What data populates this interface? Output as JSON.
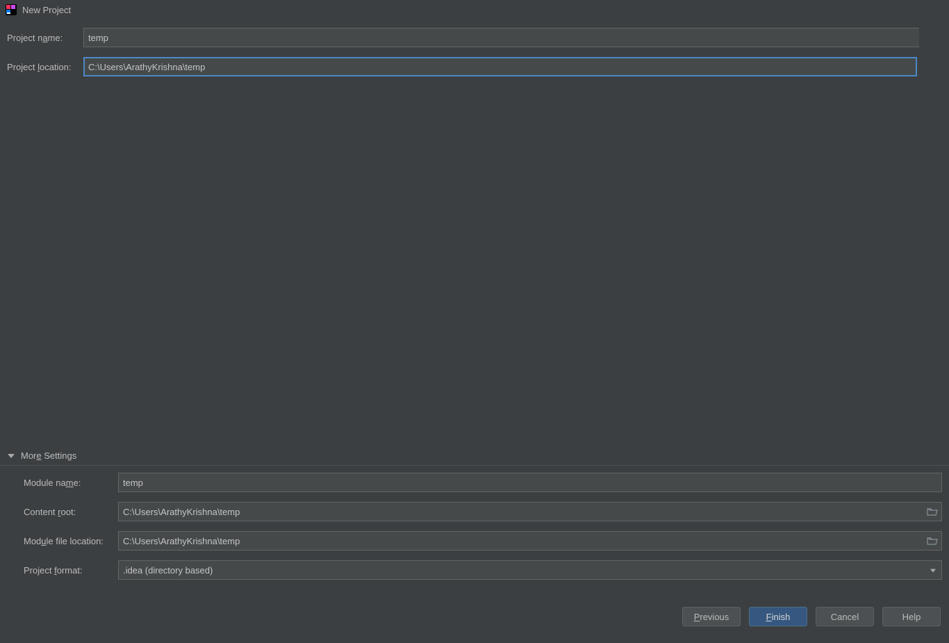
{
  "titlebar": {
    "title": "New Project"
  },
  "form": {
    "project_name_label_pre": "Project n",
    "project_name_label_m": "a",
    "project_name_label_post": "me:",
    "project_name_value": "temp",
    "project_location_label_pre": "Project ",
    "project_location_label_m": "l",
    "project_location_label_post": "ocation:",
    "project_location_value": "C:\\Users\\ArathyKrishna\\temp",
    "browse_label": "..."
  },
  "more_settings": {
    "title_pre": "Mor",
    "title_m": "e",
    "title_post": " Settings",
    "module_name_label_pre": "Module na",
    "module_name_label_m": "m",
    "module_name_label_post": "e:",
    "module_name_value": "temp",
    "content_root_label_pre": "Content ",
    "content_root_label_m": "r",
    "content_root_label_post": "oot:",
    "content_root_value": "C:\\Users\\ArathyKrishna\\temp",
    "module_file_location_label_pre": "Mod",
    "module_file_location_label_m": "u",
    "module_file_location_label_post": "le file location:",
    "module_file_location_value": "C:\\Users\\ArathyKrishna\\temp",
    "project_format_label_pre": "Project ",
    "project_format_label_m": "f",
    "project_format_label_post": "ormat:",
    "project_format_value": ".idea (directory based)"
  },
  "buttons": {
    "previous_m": "P",
    "previous_post": "revious",
    "finish_m": "F",
    "finish_post": "inish",
    "cancel": "Cancel",
    "help": "Help"
  }
}
